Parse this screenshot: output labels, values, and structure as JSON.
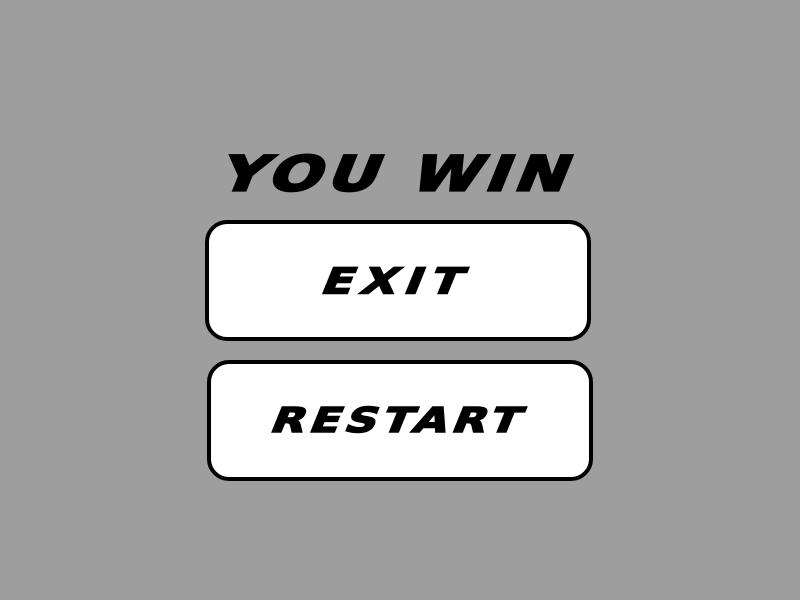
{
  "screen": {
    "title": "YOU WIN",
    "background_color": "#9e9e9e"
  },
  "buttons": {
    "exit_label": "EXIT",
    "restart_label": "RESTART",
    "fill_color": "#ffffff",
    "border_color": "#000000"
  }
}
